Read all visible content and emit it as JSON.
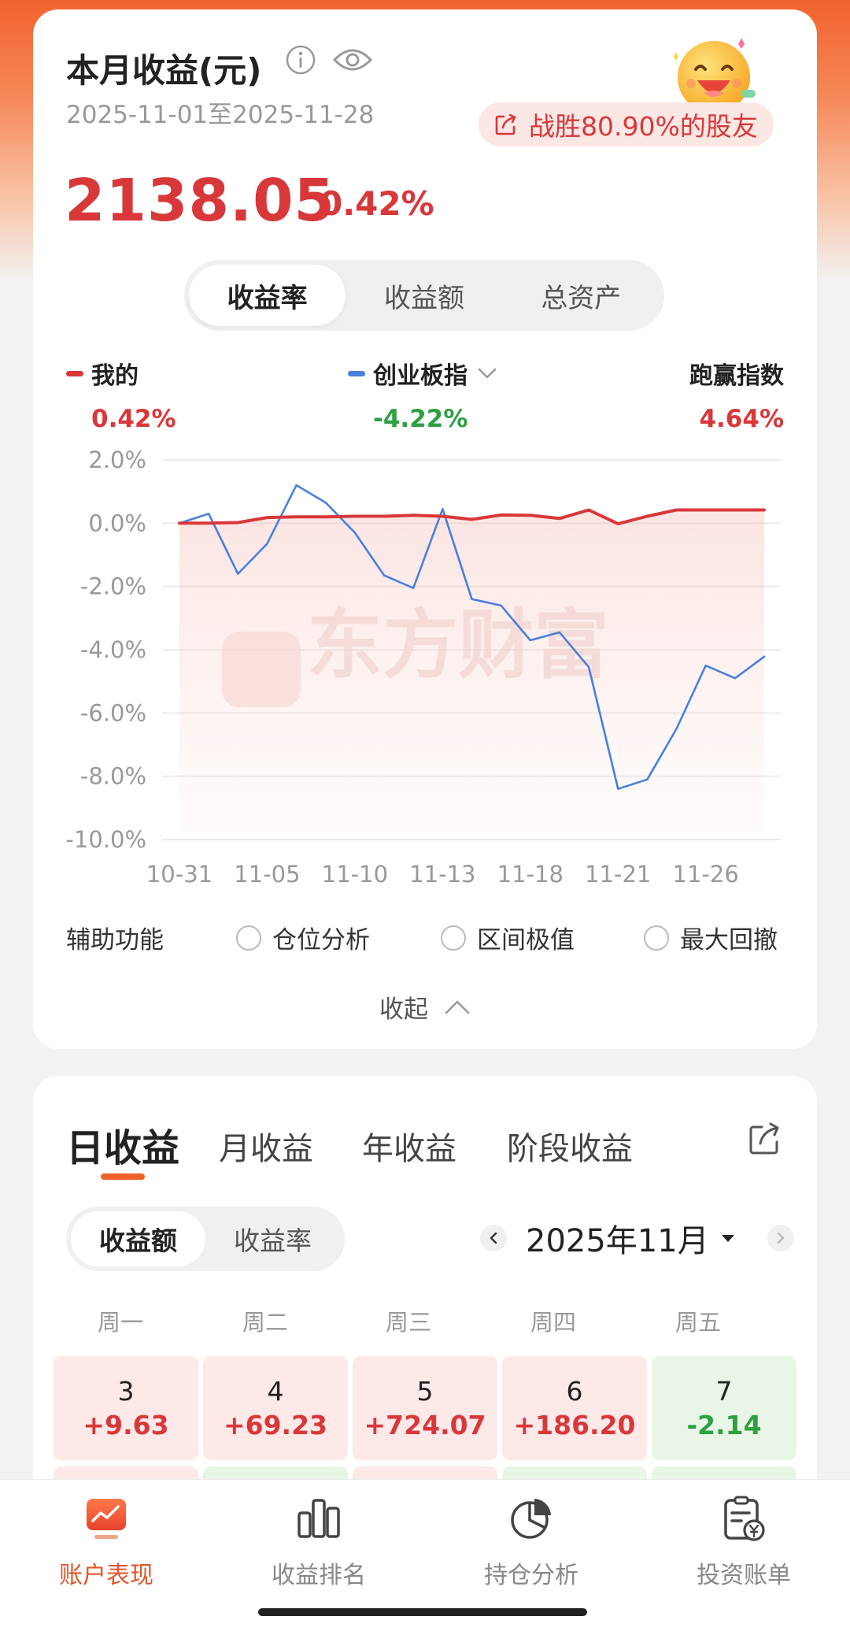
{
  "header": {
    "title": "本月收益(元)",
    "date_range": "2025-11-01至2025-11-28",
    "beat_text": "战胜80.90%的股友",
    "amount": "2138.05",
    "rate": "0.42%"
  },
  "metric_tabs": [
    "收益率",
    "收益额",
    "总资产"
  ],
  "legend": {
    "mine_label": "我的",
    "mine_value": "0.42%",
    "index_label": "创业板指",
    "index_value": "-4.22%",
    "outperform_label": "跑赢指数",
    "outperform_value": "4.64%"
  },
  "colors": {
    "mine": "#d8383a",
    "index": "#4a7fde",
    "up": "#d8383a",
    "down": "#2ea043",
    "accent": "#f0612a"
  },
  "chart_data": {
    "type": "line",
    "watermark": "东方财富",
    "x_tick_labels": [
      "10-31",
      "11-05",
      "11-10",
      "11-13",
      "11-18",
      "11-21",
      "11-26"
    ],
    "y_tick_labels": [
      "2.0%",
      "0.0%",
      "-2.0%",
      "-4.0%",
      "-6.0%",
      "-8.0%",
      "-10.0%"
    ],
    "ylim": [
      -10,
      2
    ],
    "y_unit": "%",
    "x": [
      "10-31",
      "11-03",
      "11-04",
      "11-05",
      "11-06",
      "11-07",
      "11-10",
      "11-11",
      "11-12",
      "11-13",
      "11-14",
      "11-17",
      "11-18",
      "11-19",
      "11-20",
      "11-21",
      "11-24",
      "11-25",
      "11-26",
      "11-27",
      "11-28"
    ],
    "series": [
      {
        "name": "我的",
        "color": "#d8383a",
        "values": [
          0.0,
          0.0,
          0.02,
          0.18,
          0.2,
          0.2,
          0.22,
          0.22,
          0.25,
          0.22,
          0.12,
          0.26,
          0.25,
          0.15,
          0.42,
          -0.02,
          0.22,
          0.42,
          0.42,
          0.42,
          0.42
        ]
      },
      {
        "name": "创业板指",
        "color": "#4a7fde",
        "values": [
          0.0,
          0.3,
          -1.6,
          -0.65,
          1.2,
          0.65,
          -0.3,
          -1.65,
          -2.05,
          0.45,
          -2.4,
          -2.6,
          -3.7,
          -3.45,
          -4.55,
          -8.4,
          -8.1,
          -6.5,
          -4.5,
          -4.9,
          -4.22
        ]
      }
    ],
    "grid": true
  },
  "aux": {
    "label": "辅助功能",
    "options": [
      "仓位分析",
      "区间极值",
      "最大回撤"
    ],
    "collapse": "收起"
  },
  "income_tabs": [
    "日收益",
    "月收益",
    "年收益",
    "阶段收益"
  ],
  "calendar": {
    "toggle": [
      "收益额",
      "收益率"
    ],
    "month": "2025年11月",
    "weekdays": [
      "周一",
      "周二",
      "周三",
      "周四",
      "周五"
    ],
    "days": [
      {
        "day": "3",
        "value": "+9.63",
        "dir": "up"
      },
      {
        "day": "4",
        "value": "+69.23",
        "dir": "up"
      },
      {
        "day": "5",
        "value": "+724.07",
        "dir": "up"
      },
      {
        "day": "6",
        "value": "+186.20",
        "dir": "up"
      },
      {
        "day": "7",
        "value": "-2.14",
        "dir": "down"
      }
    ],
    "next_row_dirs": [
      "up",
      "down",
      "up",
      "down",
      "down"
    ]
  },
  "bottom_nav": [
    {
      "label": "账户表现",
      "icon": "account-performance-icon",
      "active": true
    },
    {
      "label": "收益排名",
      "icon": "ranking-icon",
      "active": false
    },
    {
      "label": "持仓分析",
      "icon": "position-analysis-icon",
      "active": false
    },
    {
      "label": "投资账单",
      "icon": "investment-bill-icon",
      "active": false
    }
  ]
}
